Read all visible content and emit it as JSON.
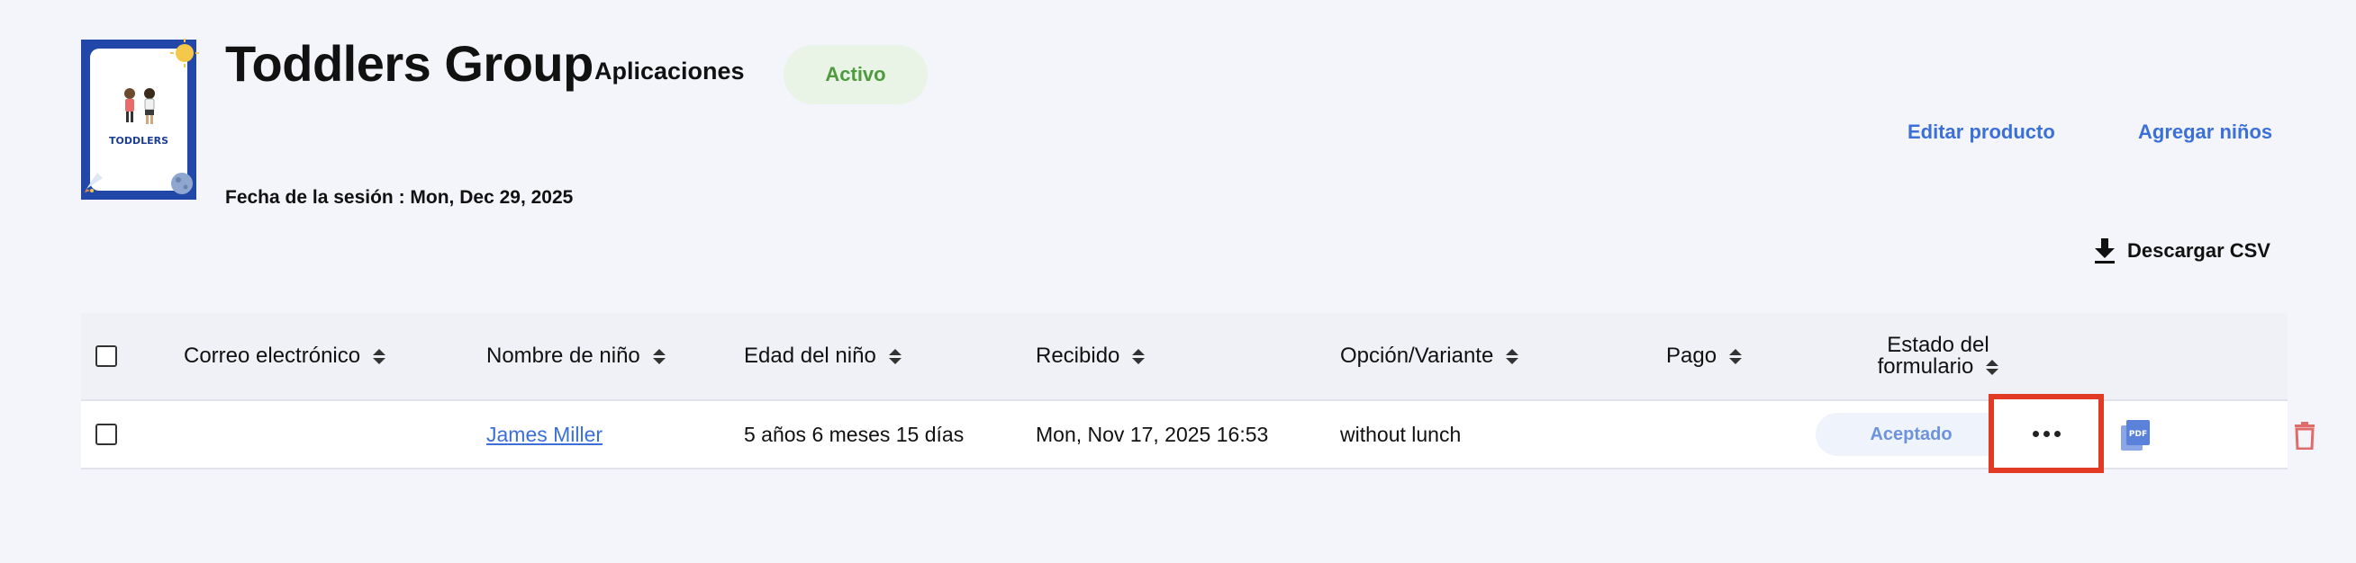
{
  "header": {
    "logo_text": "TODDLERS",
    "title": "Toddlers Group",
    "subtitle": "Aplicaciones",
    "status": "Activo",
    "session_date": "Fecha de la sesión : Mon, Dec 29, 2025"
  },
  "actions": {
    "edit_product": "Editar producto",
    "add_children": "Agregar niños",
    "download_csv": "Descargar CSV"
  },
  "table": {
    "columns": {
      "email": "Correo electrónico",
      "child_name": "Nombre de niño",
      "child_age": "Edad del niño",
      "received": "Recibido",
      "option": "Opción/Variante",
      "payment": "Pago",
      "form_status_line1": "Estado del",
      "form_status_line2": "formulario"
    },
    "rows": [
      {
        "email": "",
        "child_name": "James Miller",
        "child_age": "5 años 6 meses 15 días",
        "received": "Mon, Nov 17, 2025 16:53",
        "option": "without lunch",
        "payment": "",
        "form_status": "Aceptado"
      }
    ]
  },
  "icons": {
    "download": "download-icon",
    "sort": "sort-icon",
    "more": "more-options-icon",
    "pdf": "pdf-icon",
    "delete": "trash-icon"
  },
  "colors": {
    "accent": "#3b6fd9",
    "active_green": "#4f9a3e",
    "highlight_red": "#e13a25",
    "delete_red": "#e06b6b",
    "logo_blue": "#2147a8"
  }
}
